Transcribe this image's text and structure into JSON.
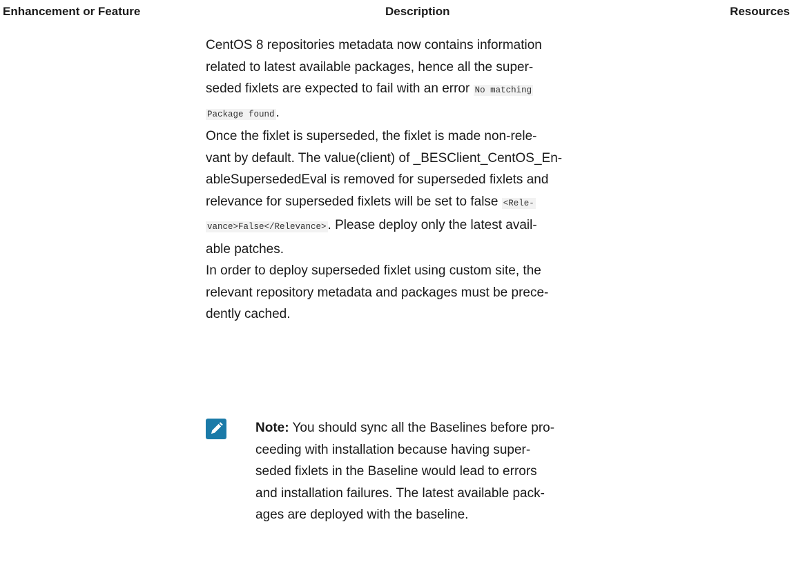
{
  "table": {
    "headers": {
      "feature": "Enhancement or Feature",
      "description": "Description",
      "resources": "Resources"
    }
  },
  "description": {
    "p1": {
      "line1": "CentOS 8 repositories metadata now contains information",
      "line2": "related to latest available packages, hence all the super-",
      "line3_text": "seded fixlets are expected to fail with an error ",
      "line3_code": "No matching",
      "line4_code": "Package found",
      "line4_end": "."
    },
    "p2": {
      "line1": "Once the fixlet is superseded, the fixlet is made non-rele-",
      "line2": "vant by default. The value(client) of _BESClient_CentOS_En-",
      "line3": "ableSupersededEval is removed for superseded fixlets and",
      "line4_text": "relevance for superseded fixlets will be set to false ",
      "line4_code": "<Rele-",
      "line5_code": "vance>False</Relevance>",
      "line5_text": ". Please deploy only the latest avail-",
      "line6": "able patches."
    },
    "p3": {
      "line1": "In order to deploy superseded fixlet using custom site, the",
      "line2": "relevant repository metadata and packages must be prece-",
      "line3": "dently cached."
    }
  },
  "note": {
    "icon": "pencil-note-icon",
    "icon_color": "#1a7aa8",
    "label": "Note:",
    "line1_text": " You should sync all the Baselines before pro-",
    "line2": "ceeding with installation because having super-",
    "line3": "seded fixlets in the Baseline would lead to errors",
    "line4": "and installation failures. The latest available pack-",
    "line5": "ages are deployed with the baseline."
  }
}
